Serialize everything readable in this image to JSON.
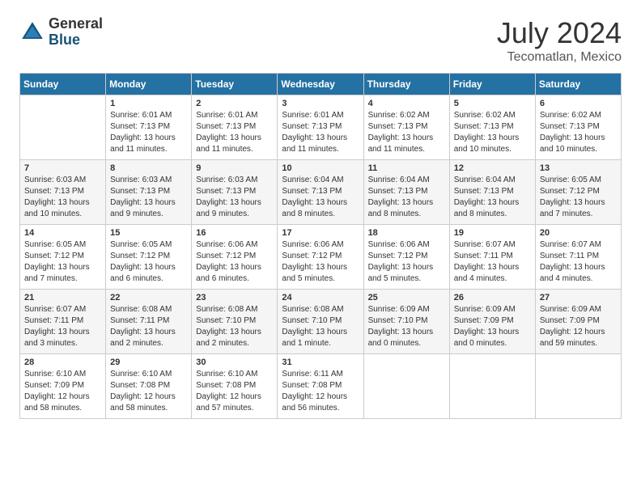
{
  "header": {
    "logo": {
      "general": "General",
      "blue": "Blue"
    },
    "title": "July 2024",
    "location": "Tecomatlan, Mexico"
  },
  "calendar": {
    "days_of_week": [
      "Sunday",
      "Monday",
      "Tuesday",
      "Wednesday",
      "Thursday",
      "Friday",
      "Saturday"
    ],
    "weeks": [
      [
        {
          "day": "",
          "sunrise": "",
          "sunset": "",
          "daylight": ""
        },
        {
          "day": "1",
          "sunrise": "Sunrise: 6:01 AM",
          "sunset": "Sunset: 7:13 PM",
          "daylight": "Daylight: 13 hours and 11 minutes."
        },
        {
          "day": "2",
          "sunrise": "Sunrise: 6:01 AM",
          "sunset": "Sunset: 7:13 PM",
          "daylight": "Daylight: 13 hours and 11 minutes."
        },
        {
          "day": "3",
          "sunrise": "Sunrise: 6:01 AM",
          "sunset": "Sunset: 7:13 PM",
          "daylight": "Daylight: 13 hours and 11 minutes."
        },
        {
          "day": "4",
          "sunrise": "Sunrise: 6:02 AM",
          "sunset": "Sunset: 7:13 PM",
          "daylight": "Daylight: 13 hours and 11 minutes."
        },
        {
          "day": "5",
          "sunrise": "Sunrise: 6:02 AM",
          "sunset": "Sunset: 7:13 PM",
          "daylight": "Daylight: 13 hours and 10 minutes."
        },
        {
          "day": "6",
          "sunrise": "Sunrise: 6:02 AM",
          "sunset": "Sunset: 7:13 PM",
          "daylight": "Daylight: 13 hours and 10 minutes."
        }
      ],
      [
        {
          "day": "7",
          "sunrise": "Sunrise: 6:03 AM",
          "sunset": "Sunset: 7:13 PM",
          "daylight": "Daylight: 13 hours and 10 minutes."
        },
        {
          "day": "8",
          "sunrise": "Sunrise: 6:03 AM",
          "sunset": "Sunset: 7:13 PM",
          "daylight": "Daylight: 13 hours and 9 minutes."
        },
        {
          "day": "9",
          "sunrise": "Sunrise: 6:03 AM",
          "sunset": "Sunset: 7:13 PM",
          "daylight": "Daylight: 13 hours and 9 minutes."
        },
        {
          "day": "10",
          "sunrise": "Sunrise: 6:04 AM",
          "sunset": "Sunset: 7:13 PM",
          "daylight": "Daylight: 13 hours and 8 minutes."
        },
        {
          "day": "11",
          "sunrise": "Sunrise: 6:04 AM",
          "sunset": "Sunset: 7:13 PM",
          "daylight": "Daylight: 13 hours and 8 minutes."
        },
        {
          "day": "12",
          "sunrise": "Sunrise: 6:04 AM",
          "sunset": "Sunset: 7:13 PM",
          "daylight": "Daylight: 13 hours and 8 minutes."
        },
        {
          "day": "13",
          "sunrise": "Sunrise: 6:05 AM",
          "sunset": "Sunset: 7:12 PM",
          "daylight": "Daylight: 13 hours and 7 minutes."
        }
      ],
      [
        {
          "day": "14",
          "sunrise": "Sunrise: 6:05 AM",
          "sunset": "Sunset: 7:12 PM",
          "daylight": "Daylight: 13 hours and 7 minutes."
        },
        {
          "day": "15",
          "sunrise": "Sunrise: 6:05 AM",
          "sunset": "Sunset: 7:12 PM",
          "daylight": "Daylight: 13 hours and 6 minutes."
        },
        {
          "day": "16",
          "sunrise": "Sunrise: 6:06 AM",
          "sunset": "Sunset: 7:12 PM",
          "daylight": "Daylight: 13 hours and 6 minutes."
        },
        {
          "day": "17",
          "sunrise": "Sunrise: 6:06 AM",
          "sunset": "Sunset: 7:12 PM",
          "daylight": "Daylight: 13 hours and 5 minutes."
        },
        {
          "day": "18",
          "sunrise": "Sunrise: 6:06 AM",
          "sunset": "Sunset: 7:12 PM",
          "daylight": "Daylight: 13 hours and 5 minutes."
        },
        {
          "day": "19",
          "sunrise": "Sunrise: 6:07 AM",
          "sunset": "Sunset: 7:11 PM",
          "daylight": "Daylight: 13 hours and 4 minutes."
        },
        {
          "day": "20",
          "sunrise": "Sunrise: 6:07 AM",
          "sunset": "Sunset: 7:11 PM",
          "daylight": "Daylight: 13 hours and 4 minutes."
        }
      ],
      [
        {
          "day": "21",
          "sunrise": "Sunrise: 6:07 AM",
          "sunset": "Sunset: 7:11 PM",
          "daylight": "Daylight: 13 hours and 3 minutes."
        },
        {
          "day": "22",
          "sunrise": "Sunrise: 6:08 AM",
          "sunset": "Sunset: 7:11 PM",
          "daylight": "Daylight: 13 hours and 2 minutes."
        },
        {
          "day": "23",
          "sunrise": "Sunrise: 6:08 AM",
          "sunset": "Sunset: 7:10 PM",
          "daylight": "Daylight: 13 hours and 2 minutes."
        },
        {
          "day": "24",
          "sunrise": "Sunrise: 6:08 AM",
          "sunset": "Sunset: 7:10 PM",
          "daylight": "Daylight: 13 hours and 1 minute."
        },
        {
          "day": "25",
          "sunrise": "Sunrise: 6:09 AM",
          "sunset": "Sunset: 7:10 PM",
          "daylight": "Daylight: 13 hours and 0 minutes."
        },
        {
          "day": "26",
          "sunrise": "Sunrise: 6:09 AM",
          "sunset": "Sunset: 7:09 PM",
          "daylight": "Daylight: 13 hours and 0 minutes."
        },
        {
          "day": "27",
          "sunrise": "Sunrise: 6:09 AM",
          "sunset": "Sunset: 7:09 PM",
          "daylight": "Daylight: 12 hours and 59 minutes."
        }
      ],
      [
        {
          "day": "28",
          "sunrise": "Sunrise: 6:10 AM",
          "sunset": "Sunset: 7:09 PM",
          "daylight": "Daylight: 12 hours and 58 minutes."
        },
        {
          "day": "29",
          "sunrise": "Sunrise: 6:10 AM",
          "sunset": "Sunset: 7:08 PM",
          "daylight": "Daylight: 12 hours and 58 minutes."
        },
        {
          "day": "30",
          "sunrise": "Sunrise: 6:10 AM",
          "sunset": "Sunset: 7:08 PM",
          "daylight": "Daylight: 12 hours and 57 minutes."
        },
        {
          "day": "31",
          "sunrise": "Sunrise: 6:11 AM",
          "sunset": "Sunset: 7:08 PM",
          "daylight": "Daylight: 12 hours and 56 minutes."
        },
        {
          "day": "",
          "sunrise": "",
          "sunset": "",
          "daylight": ""
        },
        {
          "day": "",
          "sunrise": "",
          "sunset": "",
          "daylight": ""
        },
        {
          "day": "",
          "sunrise": "",
          "sunset": "",
          "daylight": ""
        }
      ]
    ]
  }
}
